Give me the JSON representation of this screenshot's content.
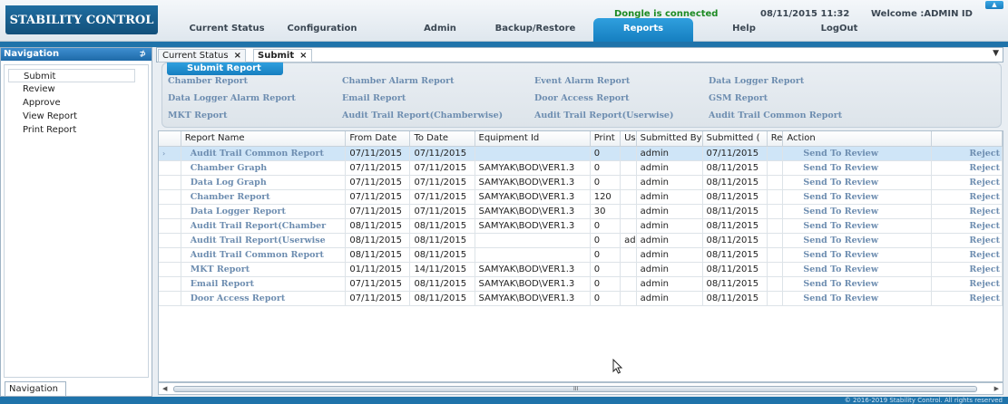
{
  "app": {
    "title": "STABILITY CONTROL",
    "dongle_status": "Dongle is connected",
    "datetime": "08/11/2015 11:32",
    "welcome": "Welcome :ADMIN ID",
    "collapse_icon": "chevron-up-icon"
  },
  "menu": {
    "items": [
      "Current Status",
      "Configuration",
      "Admin",
      "Backup/Restore",
      "Reports",
      "Help",
      "LogOut"
    ],
    "active": "Reports"
  },
  "navigation": {
    "title": "Navigation",
    "pin_icon": "pin-icon",
    "items": [
      "Submit",
      "Review",
      "Approve",
      "View Report",
      "Print Report"
    ],
    "selected": "Submit",
    "bottom_tab": "Navigation"
  },
  "tabs": [
    {
      "label": "Current Status",
      "close": "×"
    },
    {
      "label": "Submit",
      "close": "×"
    }
  ],
  "tabs_menu_icon": "dropdown-arrow-icon",
  "submit_report": {
    "title": "Submit Report",
    "links": [
      "Chamber Report",
      "Chamber Alarm Report",
      "Event Alarm Report",
      "Data Logger Report",
      "Data Logger Alarm Report",
      "Email Report",
      "Door Access Report",
      "GSM Report",
      "MKT Report",
      "Audit Trail Report(Chamberwise)",
      "Audit Trail Report(Userwise)",
      "Audit Trail Common Report"
    ]
  },
  "grid": {
    "columns": [
      "",
      "Report Name",
      "From Date",
      "To Date",
      "Equipment Id",
      "Print",
      "Us",
      "Submitted By",
      "Submitted (",
      "Re",
      "Action",
      ""
    ],
    "rows": [
      {
        "name": "Audit Trail Common Report",
        "from": "07/11/2015",
        "to": "07/11/2015",
        "equip": "",
        "print": "0",
        "us": "",
        "by": "admin",
        "submitted": "07/11/2015",
        "re": "",
        "action": "Send To Review",
        "reject": "Reject"
      },
      {
        "name": "Chamber Graph",
        "from": "07/11/2015",
        "to": "07/11/2015",
        "equip": "SAMYAK\\BOD\\VER1.3",
        "print": "0",
        "us": "",
        "by": "admin",
        "submitted": "08/11/2015",
        "re": "",
        "action": "Send To Review",
        "reject": "Reject"
      },
      {
        "name": "Data Log Graph",
        "from": "07/11/2015",
        "to": "07/11/2015",
        "equip": "SAMYAK\\BOD\\VER1.3",
        "print": "0",
        "us": "",
        "by": "admin",
        "submitted": "08/11/2015",
        "re": "",
        "action": "Send To Review",
        "reject": "Reject"
      },
      {
        "name": "Chamber Report",
        "from": "07/11/2015",
        "to": "07/11/2015",
        "equip": "SAMYAK\\BOD\\VER1.3",
        "print": "120",
        "us": "",
        "by": "admin",
        "submitted": "08/11/2015",
        "re": "",
        "action": "Send To Review",
        "reject": "Reject"
      },
      {
        "name": "Data Logger Report",
        "from": "07/11/2015",
        "to": "07/11/2015",
        "equip": "SAMYAK\\BOD\\VER1.3",
        "print": "30",
        "us": "",
        "by": "admin",
        "submitted": "08/11/2015",
        "re": "",
        "action": "Send To Review",
        "reject": "Reject"
      },
      {
        "name": "Audit Trail Report(Chamber",
        "from": "08/11/2015",
        "to": "08/11/2015",
        "equip": "SAMYAK\\BOD\\VER1.3",
        "print": "0",
        "us": "",
        "by": "admin",
        "submitted": "08/11/2015",
        "re": "",
        "action": "Send To Review",
        "reject": "Reject"
      },
      {
        "name": "Audit Trail Report(Userwise",
        "from": "08/11/2015",
        "to": "08/11/2015",
        "equip": "",
        "print": "0",
        "us": "ad",
        "by": "admin",
        "submitted": "08/11/2015",
        "re": "",
        "action": "Send To Review",
        "reject": "Reject"
      },
      {
        "name": "Audit Trail Common Report",
        "from": "08/11/2015",
        "to": "08/11/2015",
        "equip": "",
        "print": "0",
        "us": "",
        "by": "admin",
        "submitted": "08/11/2015",
        "re": "",
        "action": "Send To Review",
        "reject": "Reject"
      },
      {
        "name": "MKT Report",
        "from": "01/11/2015",
        "to": "14/11/2015",
        "equip": "SAMYAK\\BOD\\VER1.3",
        "print": "0",
        "us": "",
        "by": "admin",
        "submitted": "08/11/2015",
        "re": "",
        "action": "Send To Review",
        "reject": "Reject"
      },
      {
        "name": "Email Report",
        "from": "07/11/2015",
        "to": "08/11/2015",
        "equip": "SAMYAK\\BOD\\VER1.3",
        "print": "0",
        "us": "",
        "by": "admin",
        "submitted": "08/11/2015",
        "re": "",
        "action": "Send To Review",
        "reject": "Reject"
      },
      {
        "name": "Door Access Report",
        "from": "07/11/2015",
        "to": "08/11/2015",
        "equip": "SAMYAK\\BOD\\VER1.3",
        "print": "0",
        "us": "",
        "by": "admin",
        "submitted": "08/11/2015",
        "re": "",
        "action": "Send To Review",
        "reject": "Reject"
      }
    ],
    "selected_row": 0,
    "row_indicator": "›"
  },
  "scrollbar": {
    "left_icon": "scroll-left-icon",
    "right_icon": "scroll-right-icon",
    "grip": "III"
  },
  "footer": {
    "copyright": "© 2016-2019 Stability Control. All rights reserved"
  }
}
